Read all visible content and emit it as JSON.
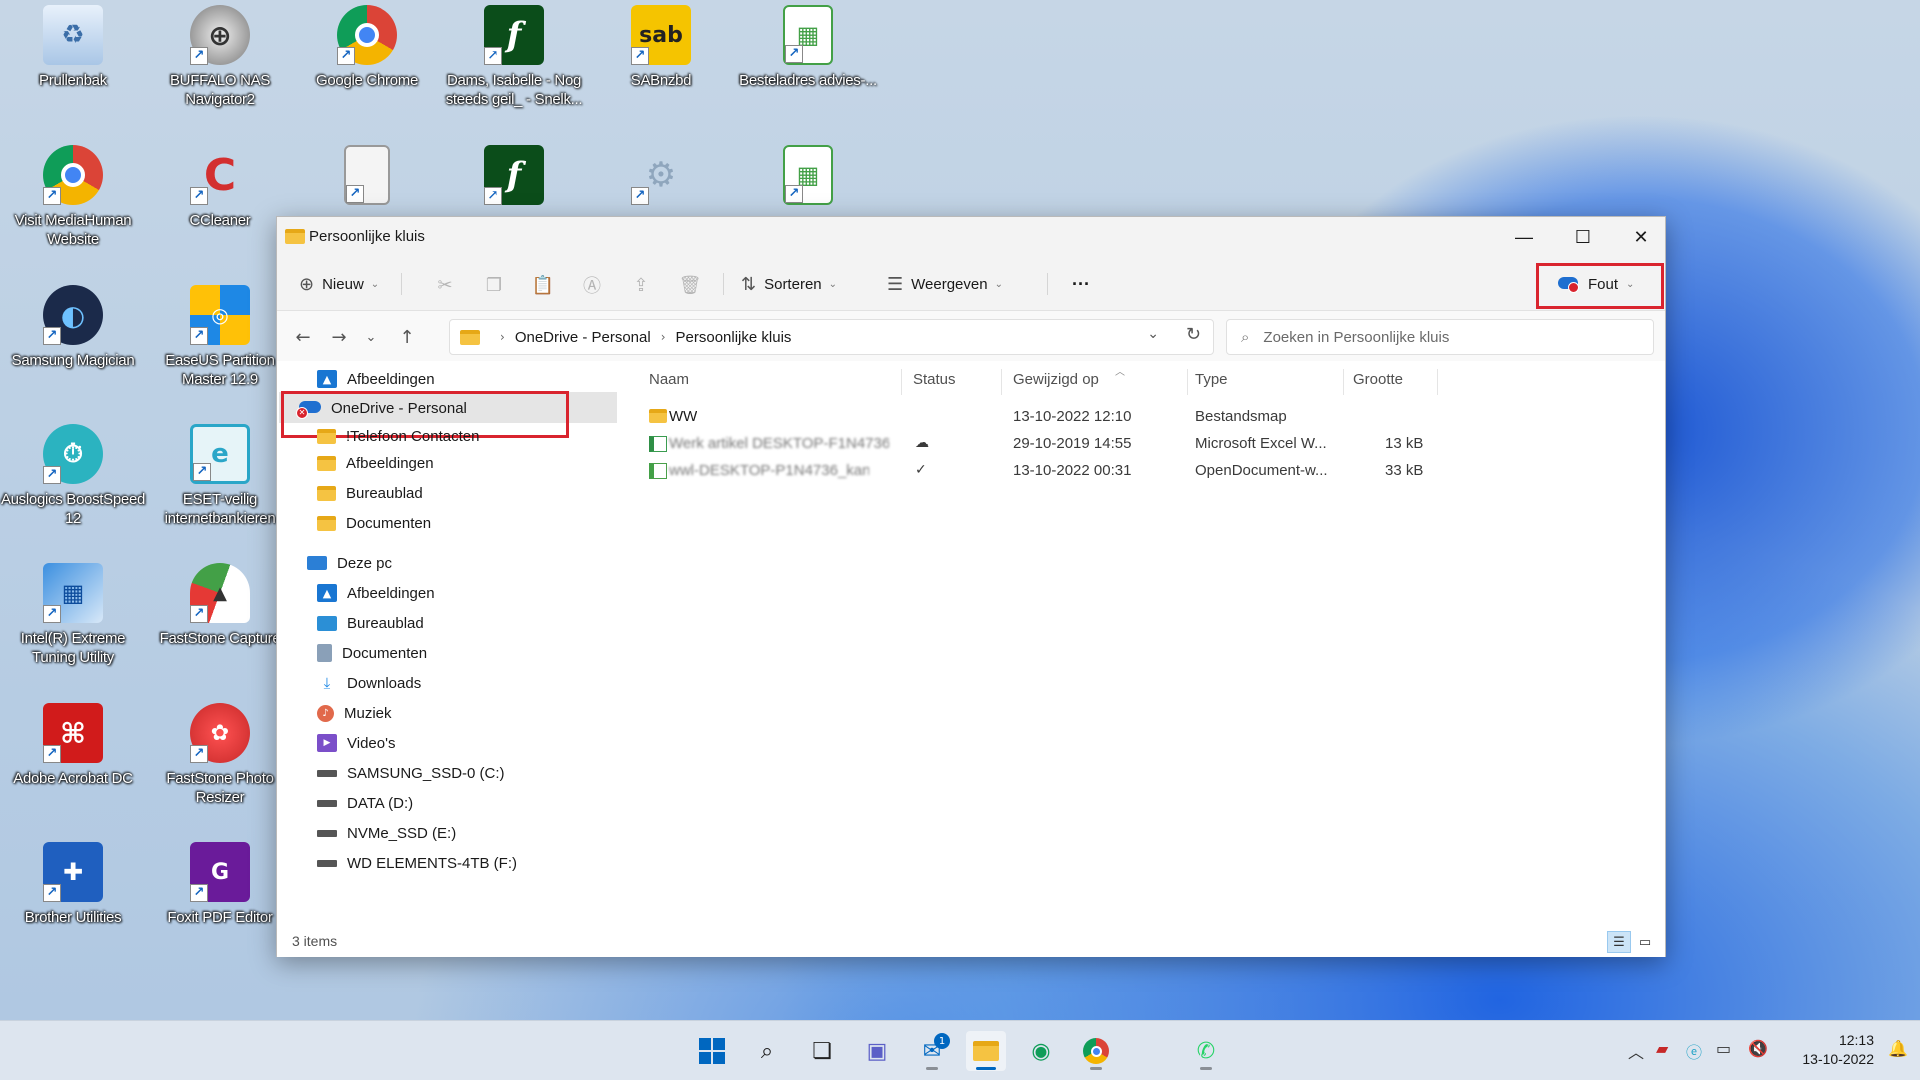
{
  "desktop": {
    "icons": [
      {
        "label": "Prullenbak"
      },
      {
        "label": "BUFFALO NAS Navigator2"
      },
      {
        "label": "Google Chrome"
      },
      {
        "label": "Dams, Isabelle - Nog steeds geil_ - Snelk..."
      },
      {
        "label": "SABnzbd"
      },
      {
        "label": "Besteladres advies-..."
      },
      {
        "label": "Visit MediaHuman Website"
      },
      {
        "label": "CCleaner"
      },
      {
        "label": "Samsung Magician"
      },
      {
        "label": "EaseUS Partition Master 12.9"
      },
      {
        "label": "Auslogics BoostSpeed 12"
      },
      {
        "label": "ESET-veilig internetbankieren"
      },
      {
        "label": "Intel(R) Extreme Tuning Utility"
      },
      {
        "label": "FastStone Capture"
      },
      {
        "label": "Adobe Acrobat DC"
      },
      {
        "label": "FastStone Photo Resizer"
      },
      {
        "label": "Brother Utilities"
      },
      {
        "label": "Foxit PDF Editor"
      }
    ]
  },
  "window": {
    "title": "Persoonlijke kluis",
    "controls": {
      "minimize": "—",
      "maximize": "☐",
      "close": "✕"
    }
  },
  "toolbar": {
    "new_label": "Nieuw",
    "sort_label": "Sorteren",
    "view_label": "Weergeven",
    "more_label": "···",
    "error_label": "Fout"
  },
  "address": {
    "crumbs": [
      "OneDrive - Personal",
      "Persoonlijke kluis"
    ]
  },
  "search": {
    "placeholder": "Zoeken in Persoonlijke kluis"
  },
  "navpane": {
    "items": [
      {
        "label": "Afbeeldingen",
        "icon": "pictures-icon"
      },
      {
        "label": "OneDrive - Personal",
        "icon": "onedrive-error-icon"
      },
      {
        "label": "!Telefoon Contacten",
        "icon": "folder-icon"
      },
      {
        "label": "Afbeeldingen",
        "icon": "folder-icon"
      },
      {
        "label": "Bureaublad",
        "icon": "folder-icon"
      },
      {
        "label": "Documenten",
        "icon": "folder-icon"
      },
      {
        "label": "Deze pc",
        "icon": "pc-icon"
      },
      {
        "label": "Afbeeldingen",
        "icon": "pictures-icon"
      },
      {
        "label": "Bureaublad",
        "icon": "desktop-icon"
      },
      {
        "label": "Documenten",
        "icon": "documents-icon"
      },
      {
        "label": "Downloads",
        "icon": "downloads-icon"
      },
      {
        "label": "Muziek",
        "icon": "music-icon"
      },
      {
        "label": "Video's",
        "icon": "videos-icon"
      },
      {
        "label": "SAMSUNG_SSD-0 (C:)",
        "icon": "system-drive-icon"
      },
      {
        "label": "DATA (D:)",
        "icon": "drive-icon"
      },
      {
        "label": "NVMe_SSD (E:)",
        "icon": "drive-icon"
      },
      {
        "label": "WD ELEMENTS-4TB (F:)",
        "icon": "drive-icon"
      }
    ]
  },
  "content": {
    "columns": [
      "Naam",
      "Status",
      "Gewijzigd op",
      "Type",
      "Grootte"
    ],
    "rows": [
      {
        "name": "WW",
        "status": "",
        "modified": "13-10-2022 12:10",
        "type": "Bestandsmap",
        "size": ""
      },
      {
        "name": "Werk artikel DESKTOP-F1N4736",
        "status": "cloud",
        "modified": "29-10-2019 14:55",
        "type": "Microsoft Excel W...",
        "size": "13 kB"
      },
      {
        "name": "wwl-DESKTOP-P1N4736_kan",
        "status": "ok",
        "modified": "13-10-2022 00:31",
        "type": "OpenDocument-w...",
        "size": "33 kB"
      }
    ]
  },
  "statusbar": {
    "item_count": "3 items"
  },
  "taskbar": {
    "mail_badge": "1",
    "clock_time": "12:13",
    "clock_date": "13-10-2022"
  },
  "colors": {
    "accent": "#0067c0",
    "highlight_box": "#d9242e",
    "folder": "#f5c342"
  }
}
